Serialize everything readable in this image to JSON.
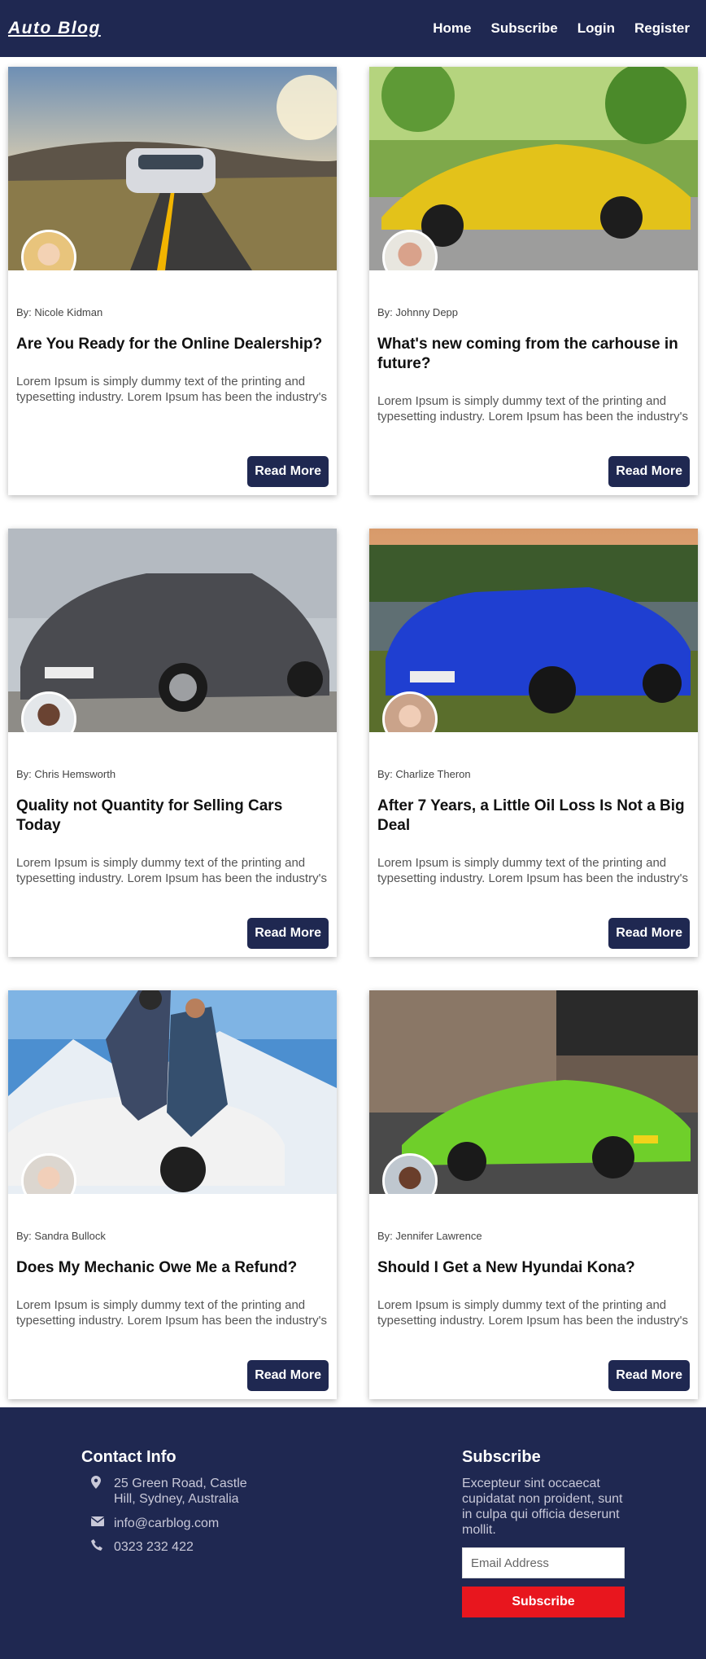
{
  "nav": {
    "brand": "Auto Blog",
    "links": [
      "Home",
      "Subscribe",
      "Login",
      "Register"
    ]
  },
  "posts": [
    {
      "author": "By: Nicole Kidman",
      "title": "Are You Ready for the Online Dealership?",
      "excerpt": "Lorem Ipsum is simply dummy text of the printing and typesetting industry. Lorem Ipsum has been the industry's",
      "button": "Read More",
      "car_color": "#d8dadf"
    },
    {
      "author": "By: Johnny Depp",
      "title": "What's new coming from the carhouse in future?",
      "excerpt": "Lorem Ipsum is simply dummy text of the printing and typesetting industry. Lorem Ipsum has been the industry's",
      "button": "Read More",
      "car_color": "#e3c21a"
    },
    {
      "author": "By: Chris Hemsworth",
      "title": "Quality not Quantity for Selling Cars Today",
      "excerpt": "Lorem Ipsum is simply dummy text of the printing and typesetting industry. Lorem Ipsum has been the industry's",
      "button": "Read More",
      "car_color": "#4a4b50"
    },
    {
      "author": "By: Charlize Theron",
      "title": "After 7 Years, a Little Oil Loss Is Not a Big Deal",
      "excerpt": "Lorem Ipsum is simply dummy text of the printing and typesetting industry. Lorem Ipsum has been the industry's",
      "button": "Read More",
      "car_color": "#1f3fd1"
    },
    {
      "author": "By: Sandra Bullock",
      "title": "Does My Mechanic Owe Me a Refund?",
      "excerpt": "Lorem Ipsum is simply dummy text of the printing and typesetting industry. Lorem Ipsum has been the industry's",
      "button": "Read More",
      "car_color": "#f2f2f2"
    },
    {
      "author": "By: Jennifer Lawrence",
      "title": "Should I Get a New Hyundai Kona?",
      "excerpt": "Lorem Ipsum is simply dummy text of the printing and typesetting industry. Lorem Ipsum has been the industry's",
      "button": "Read More",
      "car_color": "#6fcf2a"
    }
  ],
  "footer": {
    "contact_heading": "Contact Info",
    "address": "25 Green Road, Castle Hill, Sydney, Australia",
    "email": "info@carblog.com",
    "phone": "0323 232 422",
    "subscribe_heading": "Subscribe",
    "subscribe_text": "Excepteur sint occaecat cupidatat non proident, sunt in culpa qui officia deserunt mollit.",
    "email_placeholder": "Email Address",
    "subscribe_button": "Subscribe",
    "icons": [
      "map-marker-icon",
      "envelope-icon",
      "phone-icon"
    ]
  },
  "colors": {
    "navy": "#1f2851",
    "accent_red": "#e8161e"
  }
}
